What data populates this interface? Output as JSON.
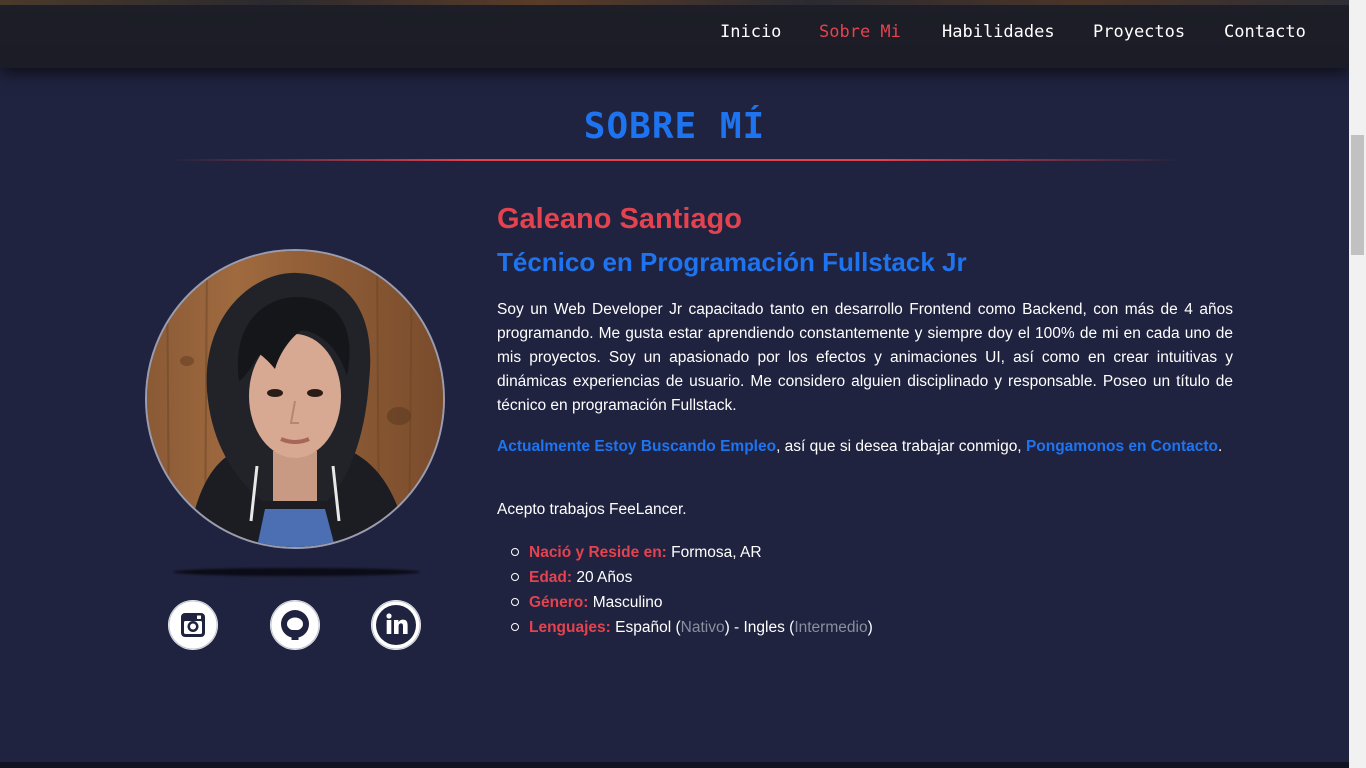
{
  "nav": {
    "items": [
      {
        "label": "Inicio",
        "active": false
      },
      {
        "label": "Sobre Mi",
        "active": true
      },
      {
        "label": "Habilidades",
        "active": false
      },
      {
        "label": "Proyectos",
        "active": false
      },
      {
        "label": "Contacto",
        "active": false
      }
    ]
  },
  "section": {
    "title": "SOBRE MÍ"
  },
  "profile": {
    "name": "Galeano Santiago",
    "role": "Técnico en Programación Fullstack Jr",
    "bio": "Soy un Web Developer Jr capacitado tanto en desarrollo Frontend como Backend, con más de 4 años programando. Me gusta estar aprendiendo constantemente y siempre doy el 100% de mi en cada uno de mis proyectos. Soy un apasionado por los efectos y animaciones UI, así como en crear intuitivas y dinámicas experiencias de usuario. Me considero alguien disciplinado y responsable. Poseo un título de técnico en programación Fullstack.",
    "status_link": "Actualmente Estoy Buscando Empleo",
    "status_middle": ", así que si desea trabajar conmigo, ",
    "contact_link": "Pongamonos en Contacto",
    "status_end": ".",
    "freelance": "Acepto trabajos FeeLancer.",
    "facts": {
      "born_label": "Nació y Reside en:",
      "born_value": " Formosa, AR",
      "age_label": "Edad:",
      "age_value": " 20 Años",
      "gender_label": "Género:",
      "gender_value": " Masculino",
      "languages_label": "Lenguajes:",
      "lang_spanish": " Español (",
      "lang_spanish_level": "Nativo",
      "lang_sep": ") - Ingles (",
      "lang_english_level": "Intermedio",
      "lang_close": ")"
    }
  },
  "social": {
    "icons": [
      "instagram-icon",
      "github-icon",
      "linkedin-icon"
    ]
  },
  "colors": {
    "background": "#20233f",
    "navbar": "#1d1e27",
    "accent_red": "#e5424f",
    "accent_blue": "#1e74f0",
    "muted": "#8b8e9e"
  }
}
